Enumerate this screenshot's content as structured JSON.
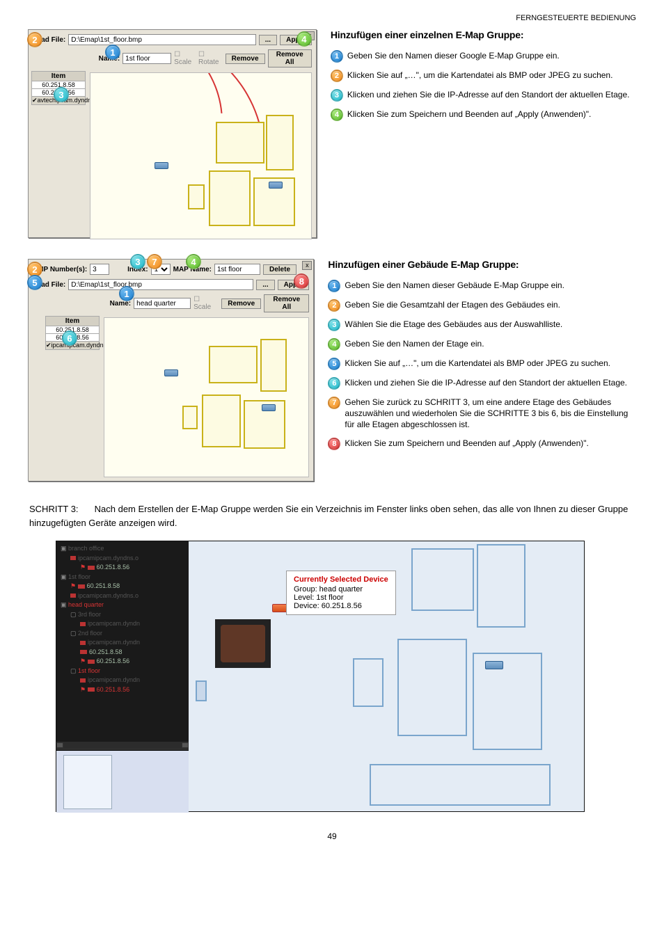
{
  "header_right": "FERNGESTEUERTE BEDIENUNG",
  "page_number": "49",
  "dlg1": {
    "loadfile_label": "Load File:",
    "loadfile_value": "D:\\Emap\\1st_floor.bmp",
    "browse": "...",
    "apply": "Apply",
    "name_label": "Name:",
    "name_value": "1st floor",
    "scale": "Scale",
    "rotate": "Rotate",
    "remove": "Remove",
    "removeall": "Remove All",
    "item_header": "Item",
    "items": [
      "60.251.8.58",
      "60.251.8.56",
      "avtechipcam.dyndns"
    ],
    "close": "x"
  },
  "dlg2": {
    "bmpnum_label": "BMP Number(s):",
    "bmpnum_value": "3",
    "index_label": "Index:",
    "index_value": "1",
    "mapname_label": "MAP Name:",
    "mapname_value": "1st floor",
    "delete": "Delete",
    "loadfile_label": "Load File:",
    "loadfile_value": "D:\\Emap\\1st_floor.bmp",
    "browse": "...",
    "apply": "Apply",
    "name_label": "Name:",
    "name_value": "head quarter",
    "scale": "Scale",
    "remove": "Remove",
    "removeall": "Remove All",
    "item_header": "Item",
    "items": [
      "60.251.8.58",
      "60.251.8.56",
      "ipcamipcam.dyndns"
    ],
    "close": "x"
  },
  "section1": {
    "title": "Hinzufügen einer einzelnen E-Map Gruppe:",
    "steps": [
      "Geben Sie den Namen dieser Google E-Map Gruppe ein.",
      "Klicken Sie auf „…\", um die Kartendatei als BMP oder JPEG zu suchen.",
      "Klicken und ziehen Sie die IP-Adresse auf den Standort der aktuellen Etage.",
      "Klicken Sie zum Speichern und Beenden auf „Apply (Anwenden)\"."
    ]
  },
  "section2": {
    "title": "Hinzufügen einer Gebäude E-Map Gruppe:",
    "steps": [
      "Geben Sie den Namen dieser Gebäude E-Map Gruppe ein.",
      "Geben Sie die Gesamtzahl der Etagen des Gebäudes ein.",
      "Wählen Sie die Etage des Gebäudes aus der Auswahlliste.",
      "Geben Sie den Namen der Etage ein.",
      "Klicken Sie auf „…\", um die Kartendatei als BMP oder JPEG zu suchen.",
      "Klicken und ziehen Sie die IP-Adresse auf den Standort der aktuellen Etage.",
      "Gehen Sie zurück zu SCHRITT 3, um eine andere Etage des Gebäudes auszuwählen und wiederholen Sie die SCHRITTE 3 bis 6, bis die Einstellung für alle Etagen abgeschlossen ist.",
      "Klicken Sie zum Speichern und Beenden auf „Apply (Anwenden)\"."
    ]
  },
  "step3": {
    "label": "SCHRITT 3:",
    "text": "Nach dem Erstellen der E-Map Gruppe werden Sie ein Verzeichnis im Fenster links oben sehen, das alle von Ihnen zu dieser Gruppe hinzugefügten Geräte anzeigen wird."
  },
  "viewer": {
    "winbtns": [
      "–",
      "□",
      "×"
    ],
    "tip_title": "Currently Selected Device",
    "tip_group": "Group: head quarter",
    "tip_level": "Level: 1st floor",
    "tip_device": "Device: 60.251.8.56",
    "tree": {
      "n1": "branch office",
      "n1a": "ipcamipcam.dyndns.o",
      "n1b": "60.251.8.56",
      "n2": "1st floor",
      "n2a": "60.251.8.58",
      "n2b": "ipcamipcam.dyndns.o",
      "n3": "head quarter",
      "n3a": "3rd floor",
      "n3a1": "ipcamipcam.dyndn",
      "n3b": "2nd floor",
      "n3b1": "ipcamipcam.dyndn",
      "n3b2": "60.251.8.58",
      "n3b3": "60.251.8.56",
      "n3c": "1st floor",
      "n3c1": "ipcamipcam.dyndn",
      "n3c2": "60.251.8.56"
    }
  }
}
